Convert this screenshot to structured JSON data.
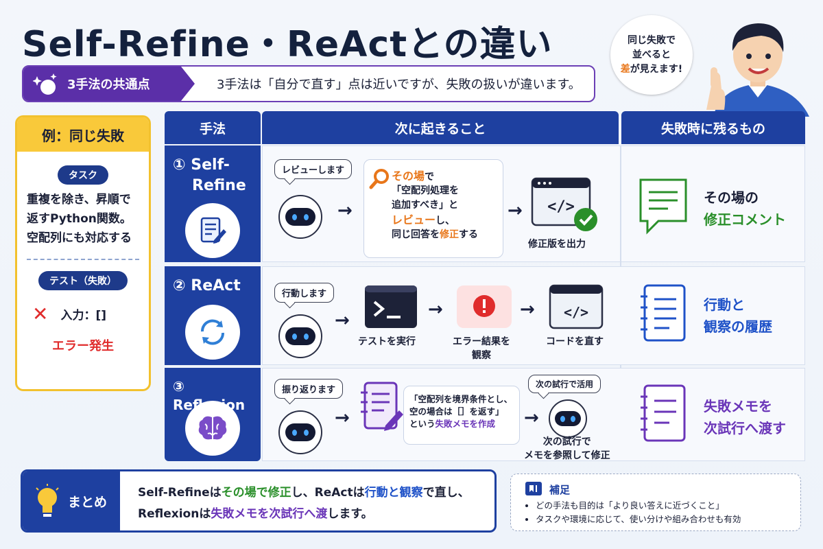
{
  "title": "Self-Refine・ReActとの違い",
  "common": {
    "label": "3手法の共通点",
    "text": "3手法は「自分で直す」点は近いですが、失敗の扱いが違います。"
  },
  "bubble": {
    "line1": "同じ失敗で",
    "line2": "並べると",
    "line3_hl": "差",
    "line3_rest": "が見えます!"
  },
  "example": {
    "header": "例：同じ失敗",
    "task_label": "タスク",
    "task_lines": [
      "重複を除き、昇順で",
      "返すPython関数。",
      "空配列にも対応する"
    ],
    "test_label": "テスト（失敗）",
    "input": "入力：[]",
    "error": "エラー発生",
    "x_mark": "✕"
  },
  "table": {
    "headers": {
      "method": "手法",
      "next": "次に起きること",
      "left": "失敗時に残るもの"
    },
    "rows": [
      {
        "method_lines": [
          "① Self-",
          "Refine"
        ],
        "say": "レビューします",
        "card_lines": [
          {
            "hl": "その場",
            "rest": "で"
          },
          {
            "plain": "「空配列処理を"
          },
          {
            "plain": "追加すべき」と"
          },
          {
            "hl": "レビュー",
            "rest": "し、"
          },
          {
            "plain_pre": "同じ回答を",
            "hl": "修正",
            "rest": "する"
          }
        ],
        "result_caption": "修正版を出力",
        "left_line1": "その場の",
        "left_line2": "修正コメント"
      },
      {
        "method_lines": [
          "② ReAct"
        ],
        "say": "行動します",
        "step1": "テストを実行",
        "step2_lines": [
          "エラー結果を",
          "観察"
        ],
        "step3": "コードを直す",
        "left_line1": "行動と",
        "left_line2": "観察の履歴"
      },
      {
        "method_lines": [
          "③ Reflexion"
        ],
        "say": "振り返ります",
        "card_lines": [
          "「空配列を境界条件とし、",
          "空の場合は［］を返す」"
        ],
        "card_line3_pre": "という",
        "card_line3_hl": "失敗メモを作成",
        "say2": "次の試行で活用",
        "next_lines": [
          "次の試行で",
          "メモを参照して修正"
        ],
        "left_line1": "失敗メモを",
        "left_line2": "次試行へ渡す"
      }
    ]
  },
  "summary": {
    "label": "まとめ",
    "line1": [
      {
        "t": "Self-Refineは",
        "c": ""
      },
      {
        "t": "その場で修正",
        "c": "green"
      },
      {
        "t": "し、ReActは",
        "c": ""
      },
      {
        "t": "行動と観察",
        "c": "blue"
      },
      {
        "t": "で直し、",
        "c": ""
      }
    ],
    "line2": [
      {
        "t": "Reflexionは",
        "c": ""
      },
      {
        "t": "失敗メモを次試行へ渡",
        "c": "purple"
      },
      {
        "t": "します。",
        "c": ""
      }
    ]
  },
  "note": {
    "title": "補足",
    "items": [
      "どの手法も目的は「より良い答えに近づくこと」",
      "タスクや環境に応じて、使い分けや組み合わせも有効"
    ]
  },
  "colors": {
    "navy": "#1e40a0",
    "purple": "#5b2fa8",
    "yellow": "#f9c93a",
    "orange": "#e8761a",
    "green": "#2a8f2a",
    "red": "#e02c2c"
  }
}
